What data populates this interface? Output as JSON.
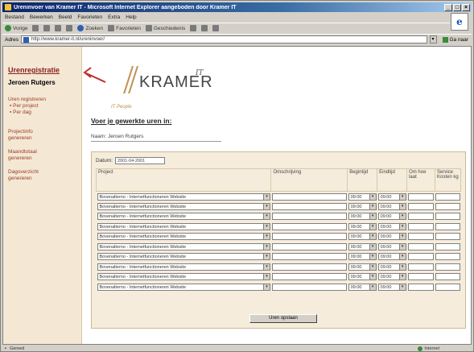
{
  "window": {
    "title": "Ureninvoer van Kramer IT - Microsoft Internet Explorer aangeboden door Kramer IT"
  },
  "menu": [
    "Bestand",
    "Bewerken",
    "Beeld",
    "Favorieten",
    "Extra",
    "Help"
  ],
  "toolbar": {
    "back_label": "Vorige",
    "search_label": "Zoeken",
    "favorites_label": "Favorieten",
    "history_label": "Geschiedenis"
  },
  "address": {
    "label": "Adres",
    "url": "http://www.kramer-it.nl/ureninvoer/",
    "go_label": "Ga naar"
  },
  "sidebar": {
    "title": "Urenregistratie",
    "user": "Jeroen Rutgers",
    "nav": [
      {
        "label": "Uren registreren",
        "subs": [
          "Per project",
          "Per dag"
        ]
      },
      {
        "label": "Projectinfo",
        "subs": [
          "genereren"
        ]
      },
      {
        "label": "Maandtotaal",
        "subs": [
          "genereren"
        ]
      },
      {
        "label": "Dagoverzicht",
        "subs": [
          "genereren"
        ]
      }
    ]
  },
  "brand": {
    "name": "KRAMER",
    "superscript": "IT",
    "tagline": "IT People"
  },
  "main": {
    "heading": "Voer je gewerkte uren in:",
    "name_label": "Naam:",
    "name_value": "Jeroen Rutgers",
    "date_label": "Datum:",
    "date_value": "2001-04-2001",
    "columns": [
      "Project",
      "Omschrijving",
      "Begintijd",
      "Eindtijd",
      "Om hoe laat",
      "Service Kosten kg"
    ],
    "rows": [
      {
        "project": "Bovenalterno - Internetfunctioneren Website",
        "begin": "09:00",
        "end": "09:00"
      },
      {
        "project": "Bovenalterno - Internetfunctioneren Website",
        "begin": "09:00",
        "end": "09:00"
      },
      {
        "project": "Bovenalterno - Internetfunctioneren Website",
        "begin": "09:00",
        "end": "09:00"
      },
      {
        "project": "Bovenalterno - Internetfunctioneren Website",
        "begin": "09:00",
        "end": "09:00"
      },
      {
        "project": "Bovenalterno - Internetfunctioneren Website",
        "begin": "09:00",
        "end": "09:00"
      },
      {
        "project": "Bovenalterno - Internetfunctioneren Website",
        "begin": "09:00",
        "end": "09:00"
      },
      {
        "project": "Bovenalterno - Internetfunctioneren Website",
        "begin": "09:00",
        "end": "09:00"
      },
      {
        "project": "Bovenalterno - Internetfunctioneren Website",
        "begin": "09:00",
        "end": "09:00"
      },
      {
        "project": "Bovenalterno - Internetfunctioneren Website",
        "begin": "09:00",
        "end": "09:00"
      },
      {
        "project": "Bovenalterno - Internetfunctioneren Website",
        "begin": "09:00",
        "end": "09:00"
      }
    ],
    "save_label": "Uren opslaan"
  },
  "status": {
    "text": "Gereed",
    "zone": "Internet"
  },
  "colors": {
    "sidebar_bg": "#f4e8d4",
    "form_bg": "#f6ecdc",
    "accent_red": "#c0302a",
    "title_bar": "#0a246a"
  }
}
